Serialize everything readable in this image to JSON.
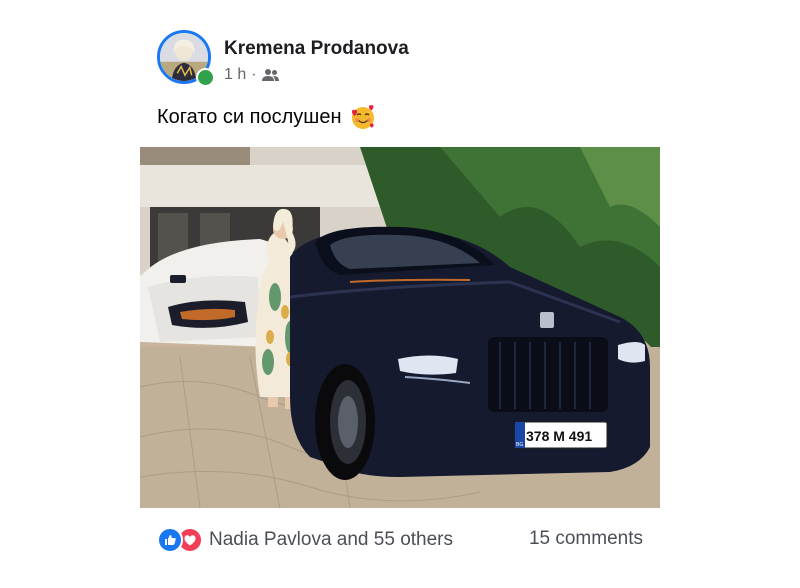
{
  "post": {
    "author": "Kremena Prodanova",
    "time": "1 h",
    "separator": "·",
    "audience_icon": "friends-icon",
    "text": "Когато си послушен",
    "emoji": "smiling-face-with-hearts"
  },
  "photo": {
    "plate": "378 M 491",
    "plate_country": "BG"
  },
  "footer": {
    "reaction_icons": [
      "like-icon",
      "love-icon"
    ],
    "reactions_text": "Nadia Pavlova and 55 others",
    "comments_text": "15 comments"
  },
  "colors": {
    "accent": "#1877f2",
    "online": "#31a24c",
    "love": "#f33e58",
    "secondary_text": "#65676b"
  }
}
